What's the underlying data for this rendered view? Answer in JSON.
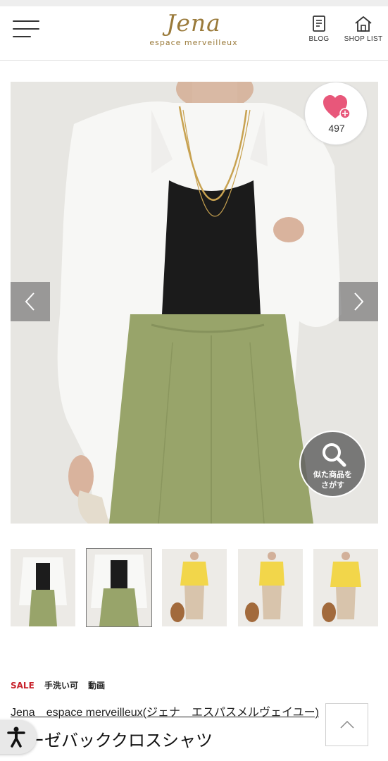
{
  "header": {
    "logo_script": "Jena",
    "logo_sub": "espace merveilleux",
    "nav": [
      {
        "label": "BLOG",
        "icon": "blog-icon"
      },
      {
        "label": "SHOP LIST",
        "icon": "shop-list-icon"
      }
    ]
  },
  "gallery": {
    "favorite_count": "497",
    "similar_search_line1": "似た商品を",
    "similar_search_line2": "さがす",
    "thumbnail_count": 5,
    "active_thumbnail": 2
  },
  "product": {
    "tags": [
      "SALE",
      "手洗い可",
      "動画"
    ],
    "brand": "Jena　espace merveilleux(ジェナ　エスパスメルヴェイユー)",
    "title": "ガーゼバッククロスシャツ"
  },
  "colors": {
    "sale": "#c8232c",
    "logo": "#9a7a3a",
    "heart": "#e8577a"
  }
}
